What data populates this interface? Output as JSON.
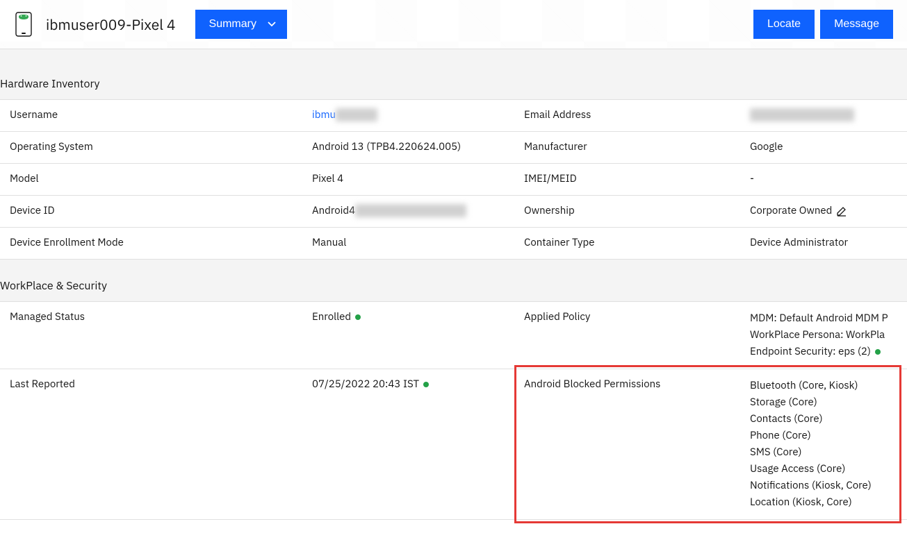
{
  "header": {
    "device_title": "ibmuser009-Pixel 4",
    "dropdown_label": "Summary",
    "actions": {
      "locate": "Locate",
      "message": "Message"
    }
  },
  "sections": {
    "hardware": {
      "title": "Hardware Inventory",
      "rows": [
        {
          "label1": "Username",
          "value1": "ibmu",
          "value1_blurred": true,
          "value1_link": true,
          "label2": "Email Address",
          "value2": "redacted",
          "value2_blurred": true
        },
        {
          "label1": "Operating System",
          "value1": "Android 13 (TPB4.220624.005)",
          "label2": "Manufacturer",
          "value2": "Google"
        },
        {
          "label1": "Model",
          "value1": "Pixel 4",
          "label2": "IMEI/MEID",
          "value2": "-"
        },
        {
          "label1": "Device ID",
          "value1": "Android4",
          "value1_partial_blur": true,
          "label2": "Ownership",
          "value2": "Corporate Owned",
          "value2_editable": true
        },
        {
          "label1": "Device Enrollment Mode",
          "value1": "Manual",
          "label2": "Container Type",
          "value2": "Device Administrator"
        }
      ]
    },
    "workplace": {
      "title": "WorkPlace & Security",
      "rows": [
        {
          "label1": "Managed Status",
          "value1": "Enrolled",
          "value1_status": true,
          "label2": "Applied Policy",
          "value2_lines": [
            {
              "text": "MDM: Default Android MDM P",
              "status": false
            },
            {
              "text": "WorkPlace Persona: WorkPla",
              "status": false
            },
            {
              "text": "Endpoint Security: eps (2)",
              "status": true
            }
          ]
        },
        {
          "label1": "Last Reported",
          "value1": "07/25/2022 20:43 IST",
          "value1_status": true,
          "label2": "Android Blocked Permissions",
          "value2_lines": [
            {
              "text": "Bluetooth (Core, Kiosk)"
            },
            {
              "text": "Storage (Core)"
            },
            {
              "text": "Contacts (Core)"
            },
            {
              "text": "Phone (Core)"
            },
            {
              "text": "SMS (Core)"
            },
            {
              "text": "Usage Access (Core)"
            },
            {
              "text": "Notifications (Kiosk, Core)"
            },
            {
              "text": "Location (Kiosk, Core)"
            }
          ],
          "highlight": true
        }
      ]
    }
  }
}
